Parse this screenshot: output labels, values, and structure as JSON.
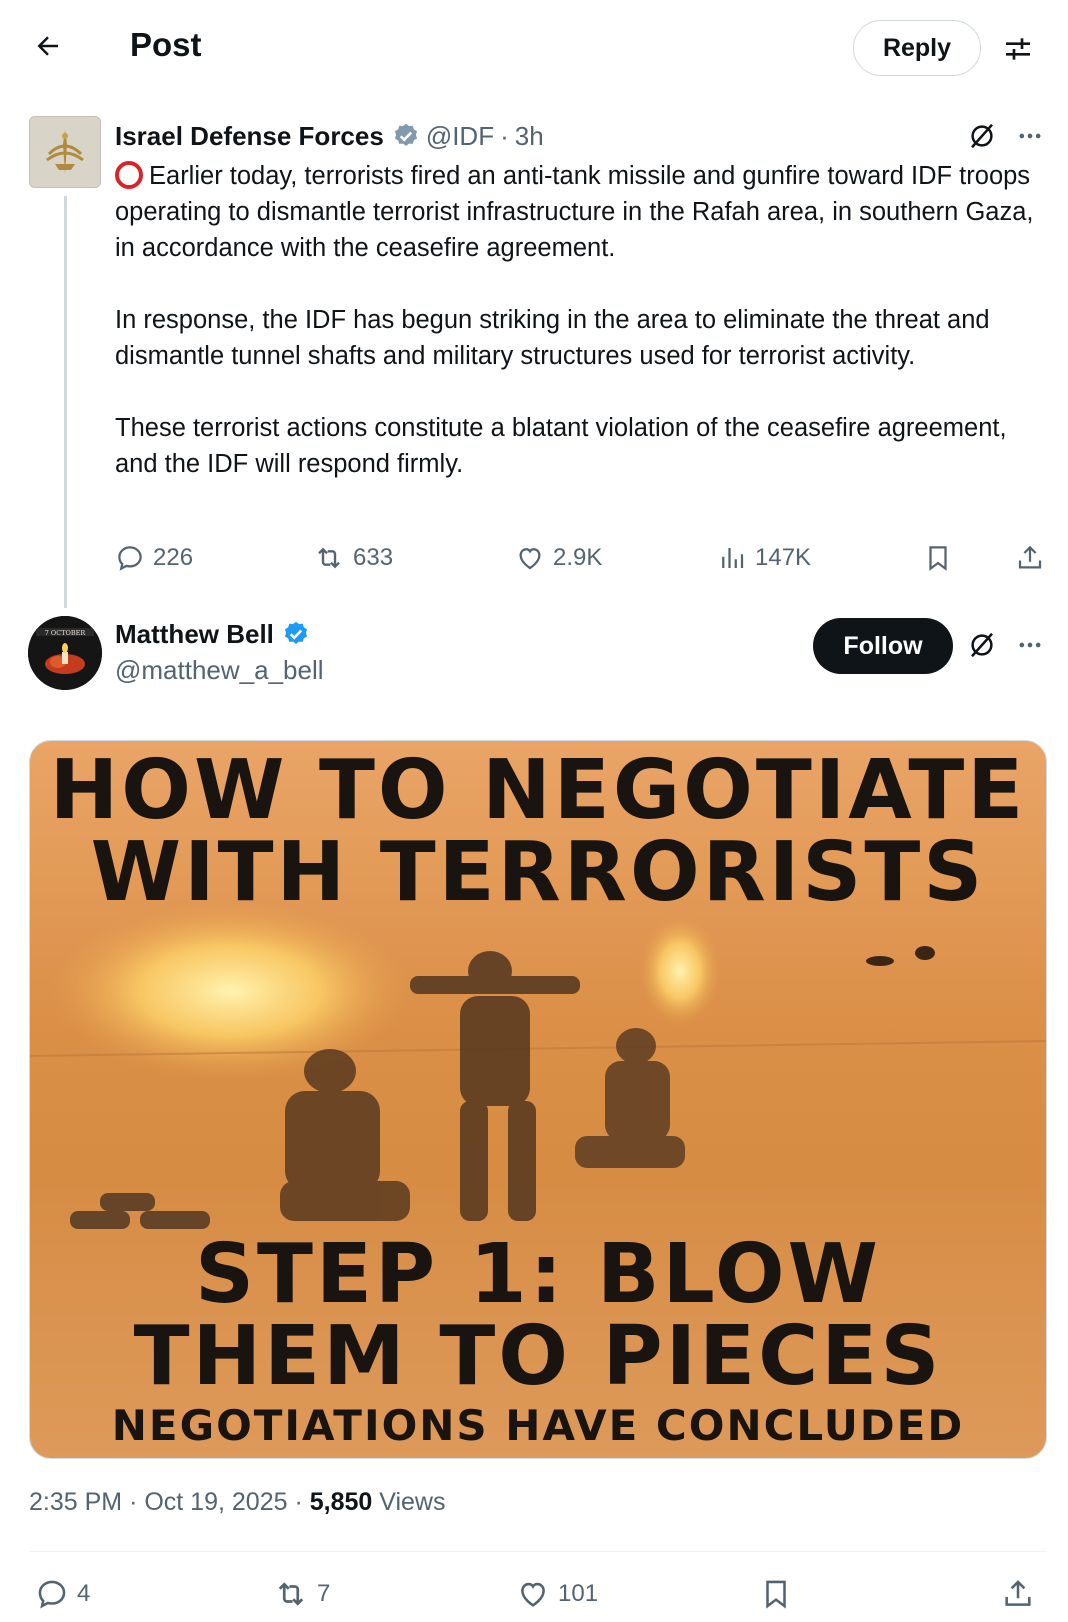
{
  "header": {
    "title": "Post",
    "reply_label": "Reply",
    "back_icon": "arrow-left-icon",
    "filter_icon": "sliders-icon"
  },
  "parent_post": {
    "author_name": "Israel Defense Forces",
    "handle": "@IDF",
    "time": "3h",
    "paragraphs": [
      "Earlier today, terrorists fired an anti-tank missile and gunfire toward IDF troops operating to dismantle terrorist infrastructure in the Rafah area, in southern Gaza, in accordance with the ceasefire agreement.",
      "In response, the IDF has begun striking in the area to eliminate the threat and dismantle tunnel shafts and military structures used for terrorist activity.",
      "These terrorist actions constitute a blatant violation of the ceasefire agreement, and the IDF will respond firmly."
    ],
    "stats": {
      "replies": "226",
      "reposts": "633",
      "likes": "2.9K",
      "views": "147K"
    },
    "verified_color": "#829aab",
    "emoji_color": "#d8232a"
  },
  "reply_post": {
    "author_name": "Matthew Bell",
    "handle": "@matthew_a_bell",
    "follow_label": "Follow",
    "verified_color": "#1d9bf0",
    "avatar_text": "7 OCTOBER",
    "meme": {
      "line1": "HOW TO NEGOTIATE",
      "line2": "WITH TERRORISTS",
      "line3": "STEP 1: BLOW",
      "line4": "THEM TO PIECES",
      "line5": "NEGOTIATIONS HAVE CONCLUDED"
    },
    "meta": {
      "time": "2:35 PM",
      "date": "Oct 19, 2025",
      "views_count": "5,850",
      "views_label": "Views"
    },
    "stats": {
      "replies": "4",
      "reposts": "7",
      "likes": "101"
    }
  }
}
